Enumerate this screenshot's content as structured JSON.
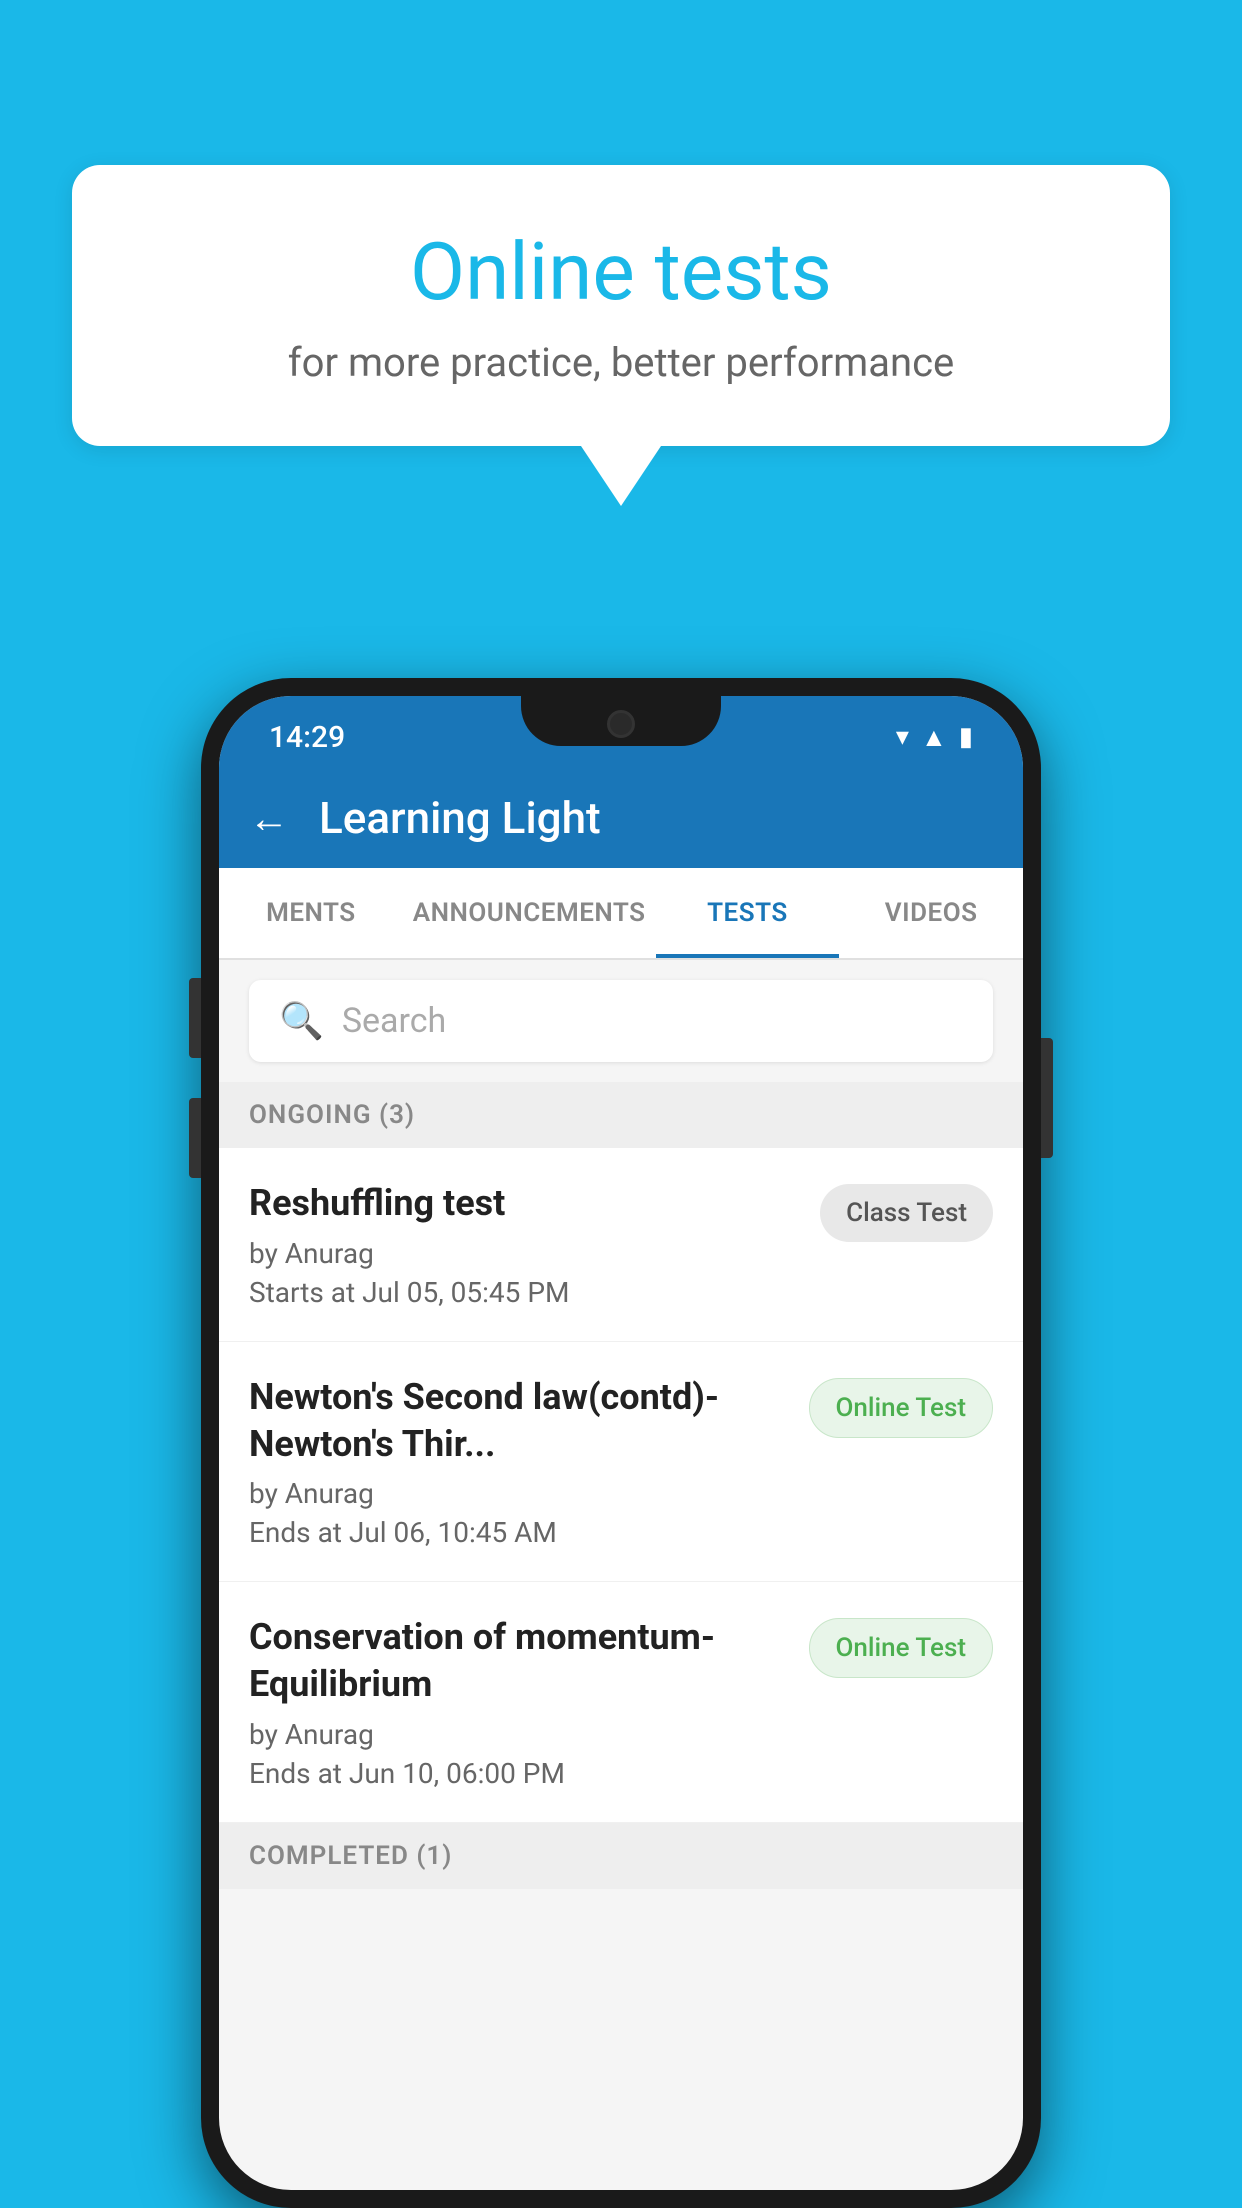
{
  "background_color": "#1ab8e8",
  "speech_bubble": {
    "title": "Online tests",
    "subtitle": "for more practice, better performance"
  },
  "phone": {
    "status_bar": {
      "time": "14:29",
      "icons": [
        "wifi",
        "signal",
        "battery"
      ]
    },
    "header": {
      "title": "Learning Light",
      "back_label": "←"
    },
    "tabs": [
      {
        "label": "MENTS",
        "active": false
      },
      {
        "label": "ANNOUNCEMENTS",
        "active": false
      },
      {
        "label": "TESTS",
        "active": true
      },
      {
        "label": "VIDEOS",
        "active": false
      }
    ],
    "search": {
      "placeholder": "Search"
    },
    "ongoing_section": {
      "label": "ONGOING (3)"
    },
    "tests": [
      {
        "name": "Reshuffling test",
        "by": "by Anurag",
        "time": "Starts at  Jul 05, 05:45 PM",
        "badge": "Class Test",
        "badge_type": "class"
      },
      {
        "name": "Newton's Second law(contd)-Newton's Thir...",
        "by": "by Anurag",
        "time": "Ends at  Jul 06, 10:45 AM",
        "badge": "Online Test",
        "badge_type": "online"
      },
      {
        "name": "Conservation of momentum-Equilibrium",
        "by": "by Anurag",
        "time": "Ends at  Jun 10, 06:00 PM",
        "badge": "Online Test",
        "badge_type": "online"
      }
    ],
    "completed_section": {
      "label": "COMPLETED (1)"
    }
  }
}
